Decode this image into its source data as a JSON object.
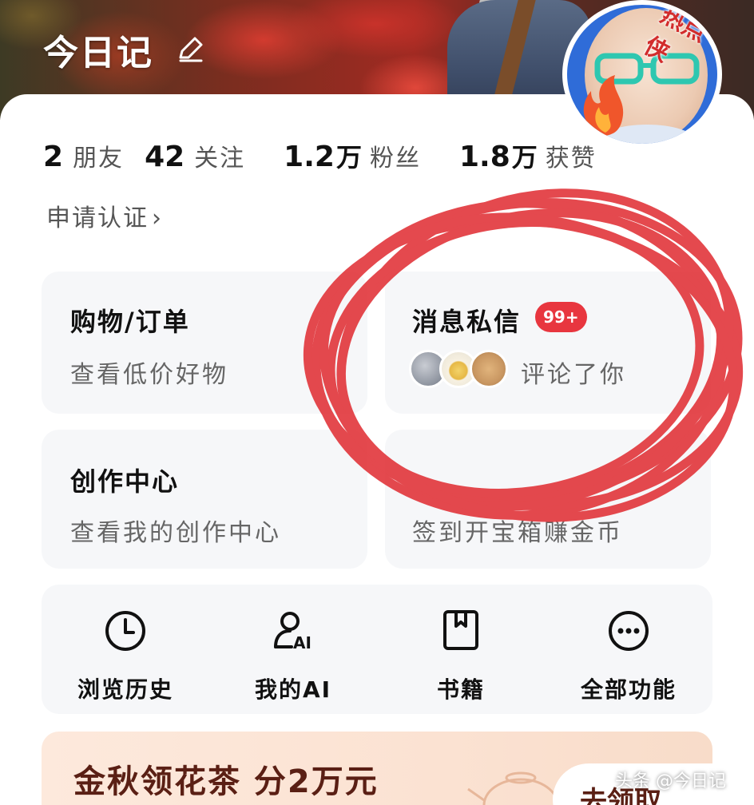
{
  "header": {
    "title": "今日记",
    "avatar_sticker": "热点侠"
  },
  "stats": [
    {
      "num": "2",
      "unit": "",
      "label": "朋友"
    },
    {
      "num": "42",
      "unit": "",
      "label": "关注"
    },
    {
      "num": "1.2",
      "unit": "万",
      "label": "粉丝"
    },
    {
      "num": "1.8",
      "unit": "万",
      "label": "获赞"
    }
  ],
  "verify": {
    "label": "申请认证",
    "chevron": "›"
  },
  "cards": {
    "shop": {
      "title": "购物/订单",
      "sub": "查看低价好物"
    },
    "message": {
      "title": "消息私信",
      "badge": "99+",
      "sub": "评论了你"
    },
    "create": {
      "title": "创作中心",
      "sub": "查看我的创作中心"
    },
    "task": {
      "sub": "签到开宝箱赚金币"
    }
  },
  "tools": [
    {
      "label": "浏览历史",
      "icon": "clock-icon"
    },
    {
      "label": "我的AI",
      "icon": "ai-person-icon"
    },
    {
      "label": "书籍",
      "icon": "book-icon"
    },
    {
      "label": "全部功能",
      "icon": "more-icon"
    }
  ],
  "promo": {
    "title": "金秋领花茶 分2万元",
    "button": "去领取"
  },
  "watermark": "头条 @今日记",
  "colors": {
    "annotation_red": "#e23a3f",
    "badge_red": "#e8363f",
    "avatar_ring": "#2f6cd8"
  }
}
